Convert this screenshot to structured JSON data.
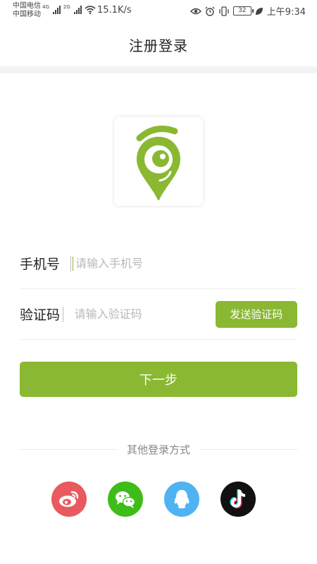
{
  "status_bar": {
    "carrier_1": "中国电信",
    "carrier_2": "中国移动",
    "net_1": "4G",
    "net_2": "2G",
    "speed": "15.1K/s",
    "battery": "32",
    "time": "上午9:34"
  },
  "header": {
    "title": "注册登录"
  },
  "logo": {
    "icon": "location-pin-eye-logo",
    "color": "#8ab832"
  },
  "form": {
    "phone_label": "手机号",
    "phone_placeholder": "请输入手机号",
    "phone_value": "",
    "code_label": "验证码",
    "code_placeholder": "请输入验证码",
    "code_value": "",
    "send_code_label": "发送验证码"
  },
  "next_button_label": "下一步",
  "other_login": {
    "label": "其他登录方式",
    "providers": [
      {
        "name": "weibo",
        "icon": "weibo-icon",
        "color": "#e85a5e"
      },
      {
        "name": "wechat",
        "icon": "wechat-icon",
        "color": "#3ebd19"
      },
      {
        "name": "qq",
        "icon": "qq-icon",
        "color": "#4fb3f2"
      },
      {
        "name": "douyin",
        "icon": "douyin-icon",
        "color": "#111111"
      }
    ]
  },
  "accent_color": "#8ab832"
}
